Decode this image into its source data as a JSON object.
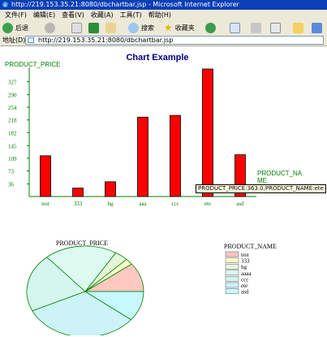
{
  "window": {
    "title": "http://219.153.35.21:8080/dbchartbar.jsp - Microsoft Internet Explorer"
  },
  "menu": [
    "文件(F)",
    "编辑(E)",
    "查看(V)",
    "收藏(A)",
    "工具(T)",
    "帮助(H)"
  ],
  "toolbar": {
    "back_label": "后退",
    "search_label": "搜索",
    "favorites_label": "收藏夹"
  },
  "address": {
    "label": "地址(D)",
    "url": "http://219.153.35.21:8080/dbchartbar.jsp"
  },
  "chart_data": [
    {
      "type": "bar",
      "title": "Chart Example",
      "ylabel": "PRODUCT_PRICE",
      "xlabel": "PRODUCT_NA\nME",
      "categories": [
        "test",
        "333",
        "hg",
        "aaa\na",
        "ccc",
        "ete",
        "asd"
      ],
      "values": [
        116,
        24,
        42,
        226,
        231,
        363,
        119
      ],
      "yticks": [
        36,
        73,
        109,
        145,
        182,
        218,
        254,
        290,
        327
      ],
      "ylim": [
        0,
        363
      ],
      "colors": {
        "bar": "#ff0000",
        "axis": "#008000",
        "title": "#000080"
      },
      "tooltip": "PRODUCT_PRICE:363.0,PRODUCT_NAME:ete"
    },
    {
      "type": "pie",
      "title": "PRODUCT_PRICE",
      "legend_title": "PRODUCT_NAME",
      "categories": [
        "test",
        "333",
        "hg",
        "aaa\na",
        "ccc",
        "ete",
        "asd"
      ],
      "legend_labels": [
        "test",
        "333",
        "hg",
        "aaaa",
        "ccc",
        "ete",
        "asd"
      ],
      "values": [
        116,
        24,
        42,
        226,
        231,
        363,
        119
      ],
      "colors": [
        "#ffc8c0",
        "#ffffd0",
        "#e4f6d8",
        "#dcfaf0",
        "#d4f6ee",
        "#ccf4f8",
        "#c8f8ff"
      ],
      "edge_color": "#008000"
    }
  ]
}
